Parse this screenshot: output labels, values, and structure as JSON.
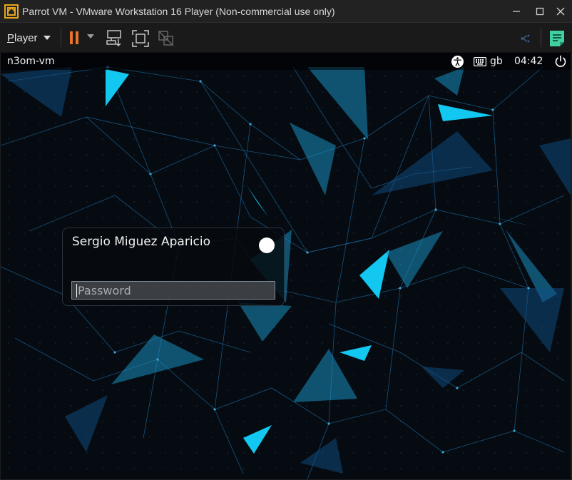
{
  "window": {
    "title": "Parrot VM - VMware Workstation 16 Player (Non-commercial use only)",
    "controls": [
      "minimize",
      "maximize",
      "close"
    ]
  },
  "toolbar": {
    "player_menu_label": "Player",
    "buttons": [
      "pause",
      "send-ctrl-alt-del",
      "fullscreen",
      "unity",
      "remote-display",
      "notes"
    ],
    "accent_color": "#e8732a",
    "notes_color": "#3fcfa0"
  },
  "guest": {
    "topbar": {
      "hostname": "n3om-vm",
      "keyboard_layout": "gb",
      "clock": "04:42"
    },
    "login": {
      "user_name": "Sergio Miguez Aparicio",
      "password_placeholder": "Password",
      "password_value": ""
    },
    "wallpaper": {
      "background": "#060b12",
      "accent": "#12c8f0"
    }
  }
}
